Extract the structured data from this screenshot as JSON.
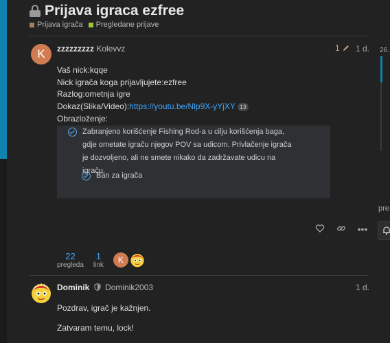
{
  "topic": {
    "title": "Prijava igraca ezfree",
    "locked": true,
    "categories": [
      {
        "label": "Prijava igrača",
        "color": "#a7815b"
      },
      {
        "label": "Pregledane prijave",
        "color": "#9ec53d"
      }
    ]
  },
  "post1": {
    "avatar_letter": "K",
    "username": "zzzzzzzzz",
    "fullname": "Kolevvz",
    "edit_count": "1",
    "date": "1 d.",
    "lines": {
      "nick": "Vaš nick:kqqe",
      "reported": "Nick igrača koga prijavljujete:ezfree",
      "reason": "Razlog:ometnja igre",
      "proof_label": "Dokaz(Slika/Video):",
      "proof_link": "https://youtu.be/Nlp9X-yYjXY",
      "proof_clicks": "13",
      "explanation": "Obrazloženje:"
    },
    "quote": {
      "item1": "Zabranjeno korišćenje Fishing Rod-a u cilju korišćenja baga, gdje ometate igraču njegov POV sa udicom. Privlačenje igrača je dozvoljeno, ali ne smete nikako da zadržavate udicu na igraču.",
      "item2": "Ban za igrača"
    }
  },
  "stats": {
    "views_value": "22",
    "views_label": "pregleda",
    "links_value": "1",
    "links_label": "link"
  },
  "post2": {
    "username": "Dominik",
    "fullname": "Dominik2003",
    "date": "1 d.",
    "line1": "Pozdrav, igrač je kažnjen.",
    "line2": "Zatvaram temu, lock!"
  },
  "timeline": {
    "date": "26.",
    "pre": "pre"
  },
  "icons": {
    "accent": "#0f82af",
    "link": "#3ea6ff",
    "avatar_k": "#d07c52"
  }
}
